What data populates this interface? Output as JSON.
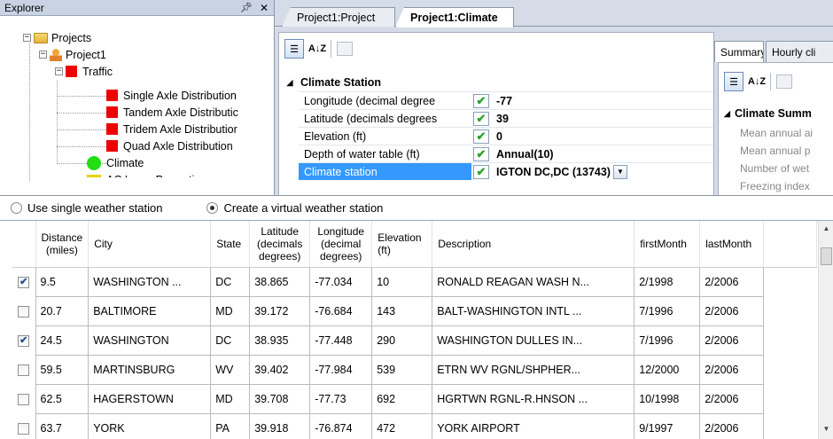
{
  "explorer": {
    "title": "Explorer",
    "pin_glyph": "\u0004",
    "close_glyph": "✕",
    "tree": {
      "projects_label": "Projects",
      "project1_label": "Project1",
      "traffic_label": "Traffic",
      "traffic_children": [
        "Single Axle Distribution",
        "Tandem Axle Distributic",
        "Tridem Axle Distributior",
        "Quad Axle Distribution"
      ],
      "climate_label": "Climate",
      "partial_label": "AC Layer Properties"
    },
    "expander_minus": "−",
    "icons": {
      "folder": "folder-icon",
      "project": "project-icon",
      "traffic": "red-square-icon",
      "climate": "green-circle-icon"
    }
  },
  "doc_tabs": [
    {
      "label": "Project1:Project"
    },
    {
      "label": "Project1:Climate",
      "active": true
    }
  ],
  "property_grid": {
    "toolbar": {
      "categorized": "categorized-icon",
      "alphabetical_label": "A↓Z",
      "pages": "property-pages-icon"
    },
    "category_label": "Climate Station",
    "collapse_glyph": "◢",
    "check_glyph": "✔",
    "dropdown_glyph": "▼",
    "rows": [
      {
        "name": "Longitude (decimal degree",
        "value": "-77"
      },
      {
        "name": "Latitude (decimals degrees",
        "value": "39"
      },
      {
        "name": "Elevation (ft)",
        "value": "0"
      },
      {
        "name": "Depth of water table (ft)",
        "value": "Annual(10)"
      },
      {
        "name": "Climate station",
        "value": "IGTON DC,DC (13743)",
        "selected": true
      }
    ]
  },
  "summary_panel": {
    "tabs": [
      "Summary",
      "Hourly cli"
    ],
    "category_label": "Climate Summ",
    "rows": [
      "Mean annual ai",
      "Mean annual p",
      "Number of wet",
      "Freezing index"
    ]
  },
  "weather_options": {
    "single_label": "Use single weather station",
    "virtual_label": "Create a virtual weather station",
    "selected": "virtual"
  },
  "grid": {
    "columns": [
      {
        "key": "check",
        "label": ""
      },
      {
        "key": "distance",
        "label": "Distance (miles)"
      },
      {
        "key": "city",
        "label": "City"
      },
      {
        "key": "state",
        "label": "State"
      },
      {
        "key": "lat",
        "label": "Latitude (decimals degrees)"
      },
      {
        "key": "lon",
        "label": "Longitude (decimal degrees)"
      },
      {
        "key": "elev",
        "label": "Elevation (ft)"
      },
      {
        "key": "desc",
        "label": "Description"
      },
      {
        "key": "first",
        "label": "firstMonth"
      },
      {
        "key": "last",
        "label": "lastMonth"
      },
      {
        "key": "extra",
        "label": ""
      }
    ],
    "check_glyph": "✔",
    "rows": [
      {
        "checked": true,
        "distance": "9.5",
        "city": "WASHINGTON ...",
        "state": "DC",
        "lat": "38.865",
        "lon": "-77.034",
        "elev": "10",
        "desc": "RONALD REAGAN WASH N...",
        "first": "2/1998",
        "last": "2/2006"
      },
      {
        "checked": false,
        "distance": "20.7",
        "city": "BALTIMORE",
        "state": "MD",
        "lat": "39.172",
        "lon": "-76.684",
        "elev": "143",
        "desc": "BALT-WASHINGTON INTL ...",
        "first": "7/1996",
        "last": "2/2006"
      },
      {
        "checked": true,
        "distance": "24.5",
        "city": "WASHINGTON",
        "state": "DC",
        "lat": "38.935",
        "lon": "-77.448",
        "elev": "290",
        "desc": "WASHINGTON DULLES IN...",
        "first": "7/1996",
        "last": "2/2006"
      },
      {
        "checked": false,
        "distance": "59.5",
        "city": "MARTINSBURG",
        "state": "WV",
        "lat": "39.402",
        "lon": "-77.984",
        "elev": "539",
        "desc": "ETRN WV RGNL/SHPHER...",
        "first": "12/2000",
        "last": "2/2006"
      },
      {
        "checked": false,
        "distance": "62.5",
        "city": "HAGERSTOWN",
        "state": "MD",
        "lat": "39.708",
        "lon": "-77.73",
        "elev": "692",
        "desc": "HGRTWN RGNL-R.HNSON ...",
        "first": "10/1998",
        "last": "2/2006"
      },
      {
        "checked": false,
        "distance": "63.7",
        "city": "YORK",
        "state": "PA",
        "lat": "39.918",
        "lon": "-76.874",
        "elev": "472",
        "desc": "YORK AIRPORT",
        "first": "9/1997",
        "last": "2/2006"
      }
    ]
  },
  "scrollbar": {
    "up_glyph": "▲",
    "down_glyph": "▼"
  }
}
